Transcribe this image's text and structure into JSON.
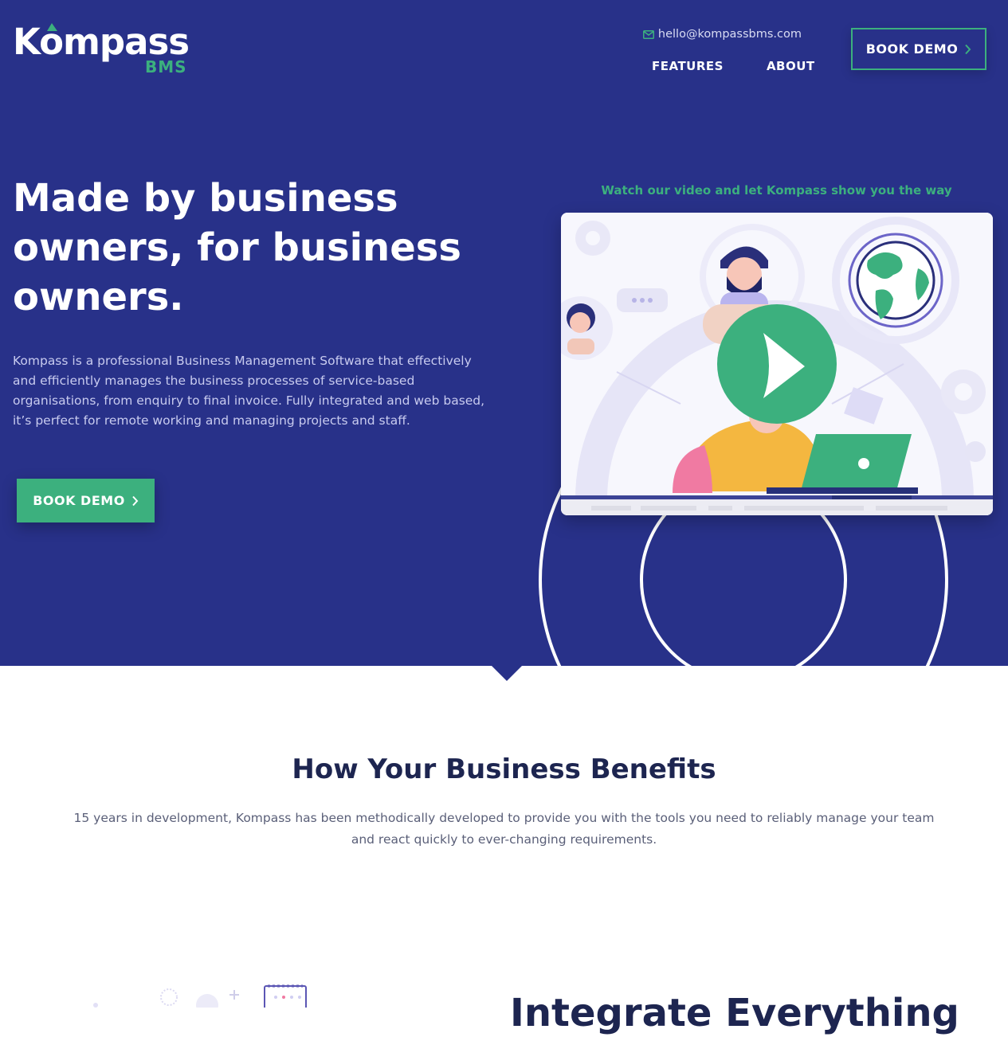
{
  "brand": {
    "name": "Kompass",
    "sub": "BMS",
    "accent": "#3cb07e",
    "primary_bg": "#283189",
    "heading_dark": "#1d2550"
  },
  "header": {
    "email": "hello@kompassbms.com",
    "nav": [
      {
        "label": "FEATURES"
      },
      {
        "label": "ABOUT"
      }
    ],
    "cta_label": "BOOK DEMO"
  },
  "hero": {
    "headline": "Made by business owners, for business owners.",
    "lead": "Kompass is a professional Business Management Software that effectively and efficiently manages the business processes of service-based organisations, from enquiry to final invoice. Fully integrated and web based, it’s perfect for remote working and managing projects and staff.",
    "cta_label": "BOOK DEMO",
    "video_caption": "Watch our video and let Kompass show you the way"
  },
  "benefits": {
    "title": "How Your Business Benefits",
    "text": "15 years in development, Kompass has been methodically developed to provide you with the tools you need to reliably manage your team and react quickly to ever-changing requirements."
  },
  "next_section": {
    "title_partial": "Integrate Everything"
  },
  "icons": [
    "mail-icon",
    "chevron-right-icon",
    "play-icon",
    "kompass-logo"
  ]
}
